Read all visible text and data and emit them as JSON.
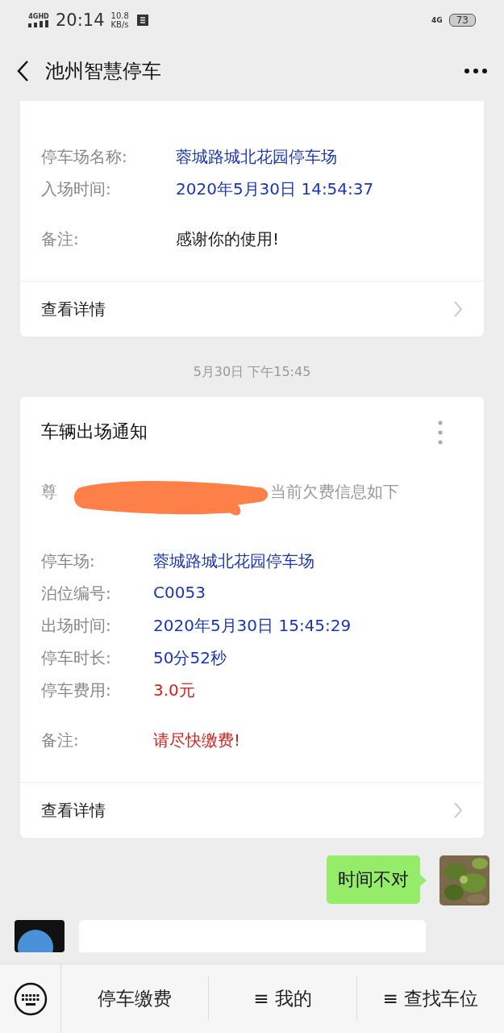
{
  "status_bar": {
    "network": "4GHD",
    "time": "20:14",
    "speed": "10.8",
    "speed_unit": "KB/s",
    "network_right": "4G",
    "battery": "73"
  },
  "nav": {
    "title": "池州智慧停车"
  },
  "cards": [
    {
      "fields": [
        {
          "label": "停车场名称:",
          "value": "蓉城路城北花园停车场",
          "color": "#1a36b4"
        },
        {
          "label": "入场时间:",
          "value": "2020年5月30日 14:54:37",
          "color": "#1a36b4"
        }
      ],
      "note": {
        "label": "备注:",
        "value": "感谢你的使用!",
        "color": "#222222"
      },
      "link": "查看详情"
    },
    {
      "timestamp": "5月30日 下午15:45",
      "title": "车辆出场通知",
      "intro_start": "尊",
      "intro_end": "当前欠费信息如下",
      "fields": [
        {
          "label": "停车场:",
          "value": "蓉城路城北花园停车场",
          "color": "#1a36b4"
        },
        {
          "label": "泊位编号:",
          "value": "C0053",
          "color": "#1a36b4"
        },
        {
          "label": "出场时间:",
          "value": "2020年5月30日 15:45:29",
          "color": "#1a36b4"
        },
        {
          "label": "停车时长:",
          "value": "50分52秒",
          "color": "#1a36b4"
        },
        {
          "label": "停车费用:",
          "value": "3.0元",
          "color": "#d21f1f"
        }
      ],
      "note": {
        "label": "备注:",
        "value": "请尽快缴费!",
        "color": "#d21f1f"
      },
      "link": "查看详情"
    }
  ],
  "message": {
    "text": "时间不对"
  },
  "menu": [
    {
      "label": "停车缴费"
    },
    {
      "label": "≡ 我的"
    },
    {
      "label": "≡ 查找车位"
    }
  ]
}
